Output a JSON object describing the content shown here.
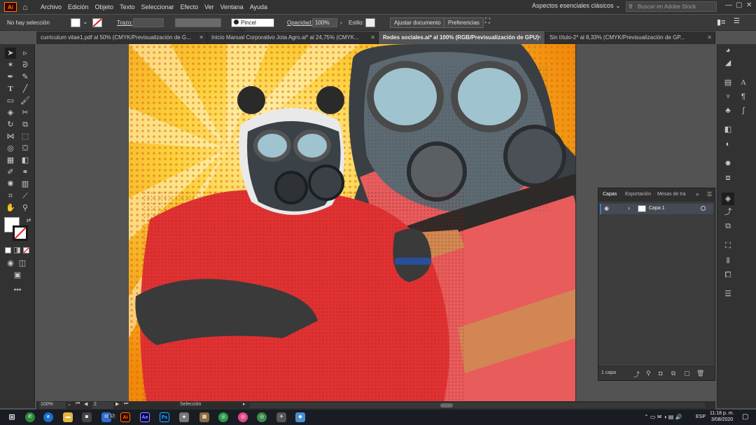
{
  "menubar": {
    "logo": "Ai",
    "items": [
      "Archivo",
      "Edición",
      "Objeto",
      "Texto",
      "Seleccionar",
      "Efecto",
      "Ver",
      "Ventana",
      "Ayuda"
    ],
    "workspace": "Aspectos esenciales clásicos",
    "search_placeholder": "Buscar en Adobe Stock"
  },
  "control": {
    "selection": "No hay selección",
    "stroke_label": "Trazo:",
    "brush": "Pincel calig...",
    "opacity_label": "Opacidad:",
    "opacity": "100%",
    "style_label": "Estilo:",
    "doc_button": "Ajustar documento",
    "prefs_button": "Preferencias"
  },
  "tabs": [
    {
      "label": "curriculum vitae1.pdf al 50% (CMYK/Previsualización de G..."
    },
    {
      "label": "Inicio Manual Corporativo Jota Agro.ai* al 24,75% (CMYK..."
    },
    {
      "label": "Redes sociales.ai* al 100% (RGB/Previsualización de GPU)"
    },
    {
      "label": "Sin título-2* al 8,33% (CMYK/Previsualización de GP..."
    }
  ],
  "layers": {
    "tabs": [
      "Capas",
      "Exportación",
      "Mesas de tra"
    ],
    "layer_name": "Capa 1",
    "count": "1 capa"
  },
  "status": {
    "zoom": "100%",
    "artboard": "2",
    "mode": "Selección"
  },
  "taskbar": {
    "lang": "ESP",
    "time": "11:18 p. m.",
    "date": "3/08/2020",
    "badge": "17"
  },
  "colors": {
    "accent": "#2f7ddb",
    "ai_orange": "#ff7c00",
    "shirt_red": "#e03232",
    "bg_yellow": "#f6b814"
  }
}
